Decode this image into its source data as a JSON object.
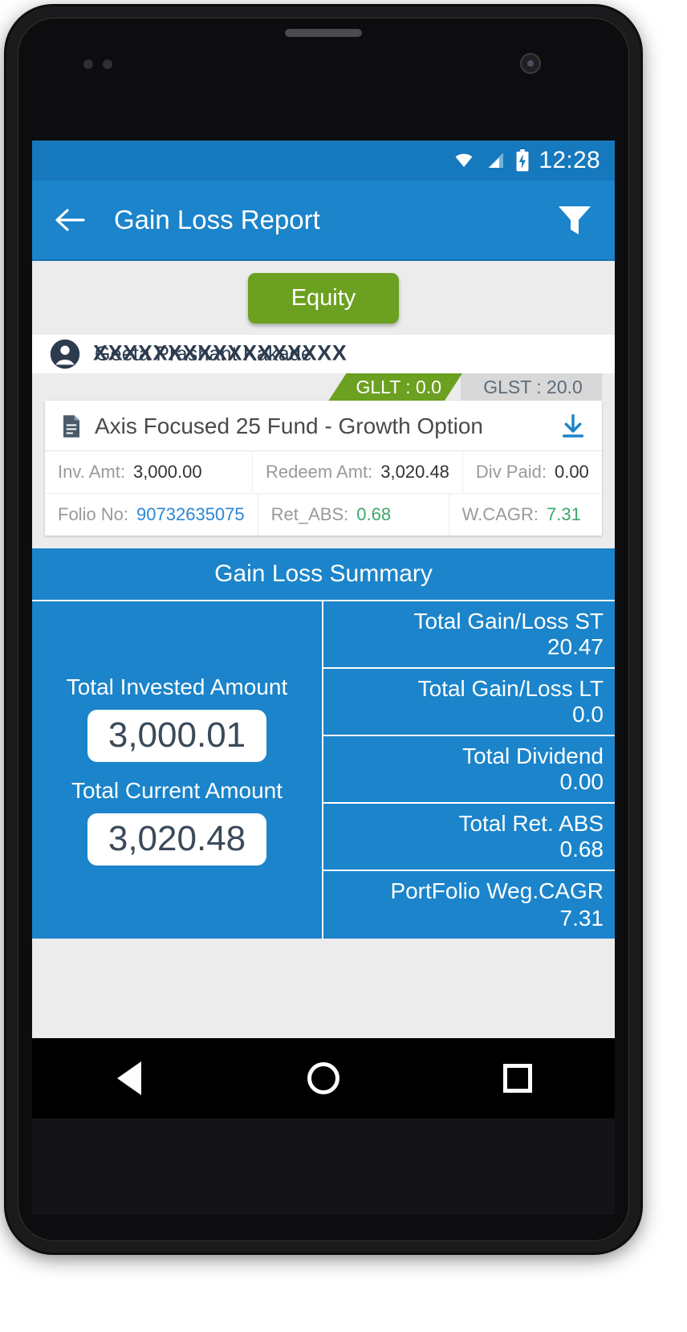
{
  "status_bar": {
    "time": "12:28",
    "icons": [
      "wifi-icon",
      "signal-icon",
      "battery-charging-icon"
    ]
  },
  "app_bar": {
    "back_icon": "arrow-back-icon",
    "title": "Gain Loss Report",
    "filter_icon": "filter-icon"
  },
  "segment": {
    "active_label": "Equity"
  },
  "investor": {
    "avatar_icon": "account-circle-icon",
    "name": "Geeta Prashant Kakade",
    "mask": "XXXXXXXXXXXXXXXXX"
  },
  "badges": {
    "gllt": "GLLT : 0.0",
    "glst": "GLST : 20.0"
  },
  "fund_card": {
    "doc_icon": "document-icon",
    "name": "Axis Focused 25 Fund - Growth Option",
    "download_icon": "download-icon",
    "rows": [
      [
        {
          "label": "Inv. Amt:",
          "value": "3,000.00",
          "style": "plain"
        },
        {
          "label": "Redeem Amt:",
          "value": "3,020.48",
          "style": "plain"
        },
        {
          "label": "Div Paid:",
          "value": "0.00",
          "style": "plain"
        }
      ],
      [
        {
          "label": "Folio No:",
          "value": "90732635075",
          "style": "link"
        },
        {
          "label": "Ret_ABS:",
          "value": "0.68",
          "style": "pos"
        },
        {
          "label": "W.CAGR:",
          "value": "7.31",
          "style": "pos"
        }
      ]
    ]
  },
  "summary": {
    "title": "Gain Loss Summary",
    "left": {
      "invested_label": "Total Invested Amount",
      "invested_value": "3,000.01",
      "current_label": "Total Current Amount",
      "current_value": "3,020.48"
    },
    "right": [
      {
        "label": "Total Gain/Loss ST",
        "value": "20.47"
      },
      {
        "label": "Total Gain/Loss LT",
        "value": "0.0"
      },
      {
        "label": "Total Dividend",
        "value": "0.00"
      },
      {
        "label": "Total Ret. ABS",
        "value": "0.68"
      },
      {
        "label": "PortFolio Weg.CAGR",
        "value": "7.31"
      }
    ]
  },
  "nav_bar": {
    "back_icon": "nav-back-triangle-icon",
    "home_icon": "nav-home-circle-icon",
    "recents_icon": "nav-recents-square-icon"
  },
  "colors": {
    "primary_blue": "#1b84ca",
    "status_blue": "#1678bd",
    "accent_green": "#6ca021",
    "link_blue": "#2a87d8",
    "positive_green": "#3aa869",
    "page_grey": "#ececec"
  }
}
